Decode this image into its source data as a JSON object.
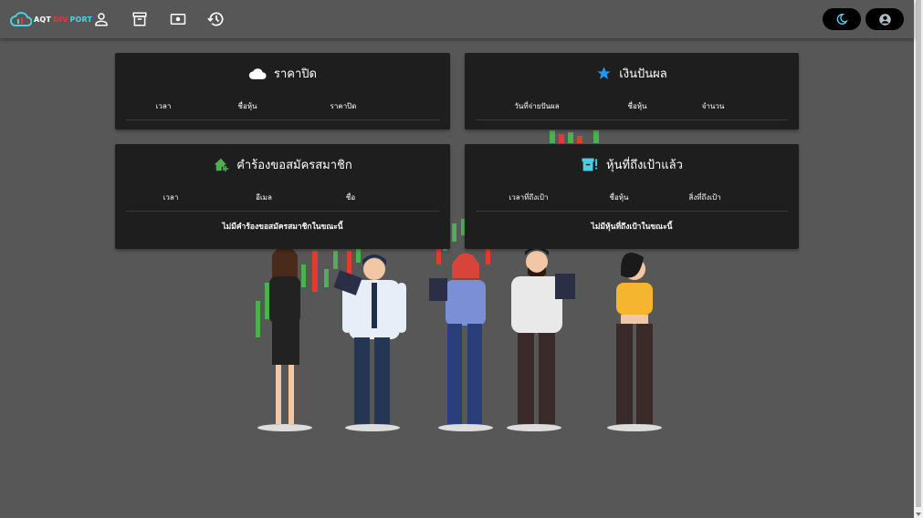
{
  "app": {
    "logo_text_part1": "AQT",
    "logo_text_part2": "DIV",
    "logo_text_part3": "PORT"
  },
  "nav": {
    "icons": [
      "person-icon",
      "archive-icon",
      "cash-icon",
      "history-icon"
    ],
    "right_buttons": [
      "dark-mode-icon",
      "account-icon"
    ]
  },
  "colors": {
    "appbar_bg": "#575757",
    "card_bg": "#1e1e1e",
    "cloud_icon": "#ffffff",
    "star_icon": "#2196f3",
    "home_icon": "#4caf50",
    "archive_alert_icon": "#4dd0e1",
    "logo_cyan": "#4dd0e1",
    "logo_red": "#e53935",
    "candle_green": "#4caf50",
    "candle_red": "#e53935"
  },
  "cards": {
    "closing_price": {
      "icon": "cloud-icon",
      "title": "ราคาปิด",
      "columns": [
        "เวลา",
        "ชื่อหุ้น",
        "ราคาปิด"
      ]
    },
    "dividend": {
      "icon": "star-icon",
      "title": "เงินปันผล",
      "columns": [
        "วันที่จ่ายปันผล",
        "ชื่อหุ้น",
        "จำนวน"
      ]
    },
    "membership_requests": {
      "icon": "home-add-icon",
      "title": "คำร้องขอสมัครสมาชิก",
      "columns": [
        "เวลา",
        "อีเมล",
        "ชื่อ"
      ],
      "empty_text": "ไม่มีคำร้องขอสมัครสมาชิกในขณะนี้"
    },
    "target_reached": {
      "icon": "archive-alert-icon",
      "title": "หุ้นที่ถึงเป้าแล้ว",
      "columns": [
        "เวลาที่ถึงเป้า",
        "ชื่อหุ้น",
        "สิ่งที่ถึงเป้า"
      ],
      "empty_text": "ไม่มีหุ้นที่ถึงเป้าในขณะนี้"
    }
  }
}
